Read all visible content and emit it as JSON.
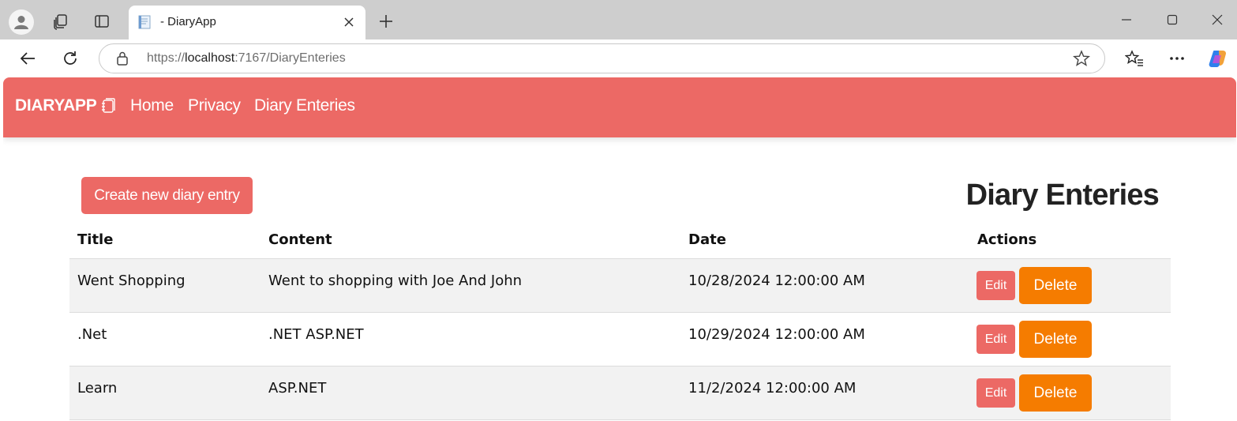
{
  "browser": {
    "tab_title": "- DiaryApp",
    "url_prefix": "https://",
    "url_host": "localhost",
    "url_rest": ":7167/DiaryEnteries",
    "icons": [
      "profile-icon",
      "collections-icon",
      "tab-actions-icon",
      "favicon-icon",
      "close-icon",
      "plus-icon",
      "minimize-icon",
      "maximize-icon",
      "window-close-icon",
      "back-icon",
      "reload-icon",
      "lock-icon",
      "star-icon",
      "favorites-icon",
      "more-icon",
      "copilot-icon"
    ]
  },
  "navbar": {
    "brand": "DIARYAPP",
    "brand_icon": "notebook-icon",
    "links": [
      "Home",
      "Privacy",
      "Diary Enteries"
    ]
  },
  "main": {
    "create_button": "Create new diary entry",
    "title": "Diary Enteries",
    "table": {
      "headers": [
        "Title",
        "Content",
        "Date",
        "Actions"
      ],
      "rows": [
        {
          "title": "Went Shopping",
          "content": "Went to shopping with Joe And John",
          "date": "10/28/2024 12:00:00 AM",
          "edit": "Edit",
          "delete": "Delete"
        },
        {
          "title": ".Net",
          "content": ".NET ASP.NET",
          "date": "10/29/2024 12:00:00 AM",
          "edit": "Edit",
          "delete": "Delete"
        },
        {
          "title": "Learn",
          "content": "ASP.NET",
          "date": "11/2/2024 12:00:00 AM",
          "edit": "Edit",
          "delete": "Delete"
        }
      ]
    }
  },
  "colors": {
    "primary": "#ec6965",
    "danger": "#f57c00",
    "stripe": "#f2f2f2"
  }
}
